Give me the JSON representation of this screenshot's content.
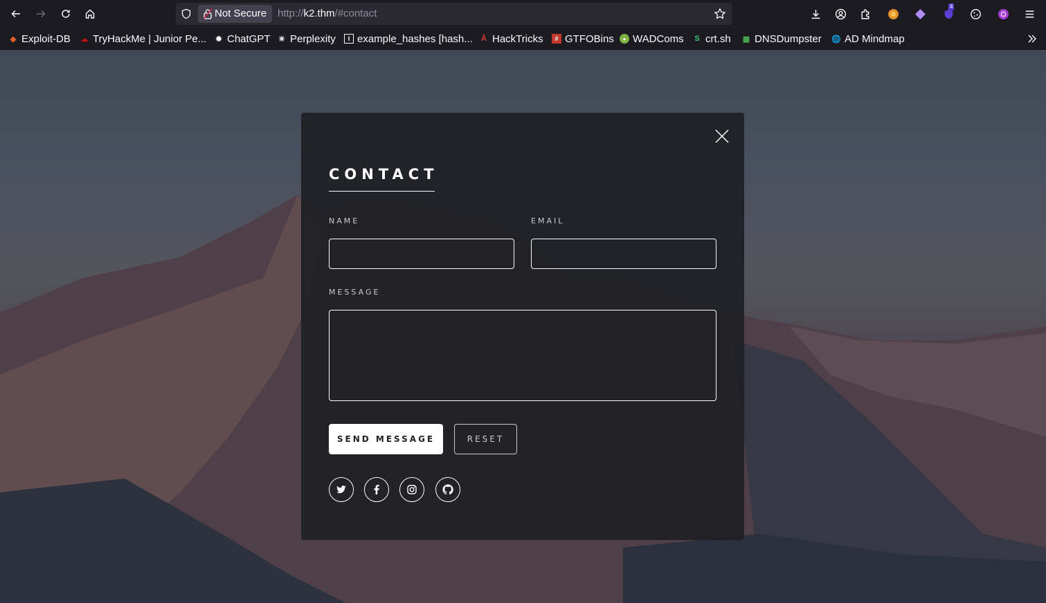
{
  "browser": {
    "security_label": "Not Secure",
    "url_prefix": "http://",
    "url_host": "k2.thm",
    "url_path": "/#contact",
    "extension_badge": "4"
  },
  "bookmarks": [
    {
      "label": "Exploit-DB",
      "icon": "exploitdb-icon",
      "color": "#e8612c"
    },
    {
      "label": "TryHackMe | Junior Pe...",
      "icon": "tryhackme-icon",
      "color": "#c11111"
    },
    {
      "label": "ChatGPT",
      "icon": "chatgpt-icon",
      "color": "#fbfbfe"
    },
    {
      "label": "Perplexity",
      "icon": "perplexity-icon",
      "color": "#fbfbfe"
    },
    {
      "label": "example_hashes [hash...",
      "icon": "hashcat-icon",
      "color": "#fbfbfe"
    },
    {
      "label": "HackTricks",
      "icon": "hacktricks-icon",
      "color": "#d93a3a"
    },
    {
      "label": "GTFOBins",
      "icon": "gtfobins-icon",
      "color": "#c0392b"
    },
    {
      "label": "WADComs",
      "icon": "wadcoms-icon",
      "color": "#7cb342"
    },
    {
      "label": "crt.sh",
      "icon": "crtsh-icon",
      "color": "#2ecc71"
    },
    {
      "label": "DNSDumpster",
      "icon": "dnsdumpster-icon",
      "color": "#4caf50"
    },
    {
      "label": "AD Mindmap",
      "icon": "globe-icon",
      "color": "#fbfbfe"
    }
  ],
  "contact": {
    "title": "CONTACT",
    "name_label": "NAME",
    "email_label": "EMAIL",
    "message_label": "MESSAGE",
    "name_value": "",
    "email_value": "",
    "message_value": "",
    "send_label": "SEND MESSAGE",
    "reset_label": "RESET",
    "socials": [
      "twitter-icon",
      "facebook-icon",
      "instagram-icon",
      "github-icon"
    ]
  }
}
